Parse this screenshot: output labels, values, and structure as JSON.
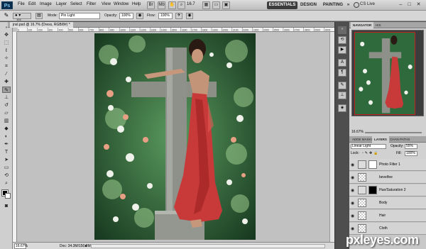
{
  "menubar": {
    "logo": "Ps",
    "menus": [
      "File",
      "Edit",
      "Image",
      "Layer",
      "Select",
      "Filter",
      "View",
      "Window",
      "Help"
    ],
    "zoom": "16.7",
    "workspaces": [
      "ESSENTIALS",
      "DESIGN",
      "PAINTING",
      "»"
    ],
    "cs_live": "CS Live",
    "window_controls": [
      "–",
      "□",
      "✕"
    ]
  },
  "options": {
    "brush_size": "104",
    "mode_label": "Mode:",
    "mode_value": "Pin Light",
    "opacity_label": "Opacity:",
    "opacity_value": "100%",
    "flow_label": "Flow:",
    "flow_value": "100%"
  },
  "document": {
    "tab_title": "jnsl.psd @ 16.7% (Dress, RGB/8#) *",
    "zoom_status": "16.67%",
    "doc_info": "Doc: 34.3M/150.2M",
    "ruler_ticks": [
      "0",
      "100",
      "200",
      "300",
      "400",
      "500",
      "600",
      "700",
      "800",
      "900",
      "1000",
      "1100",
      "1200",
      "1300",
      "1400",
      "1500",
      "1600",
      "1700",
      "1800",
      "1900",
      "2000",
      "2100",
      "2200",
      "2300",
      "2400",
      "2500",
      "2600",
      "2700",
      "2800",
      "2900",
      "3000"
    ]
  },
  "navigator": {
    "tabs": [
      "NAVIGATOR",
      "HIS"
    ],
    "zoom": "16.67%"
  },
  "layers_panel": {
    "tabs": [
      "ADDE MASKS",
      "LAYERS",
      "CHAN PATHS"
    ],
    "blend_mode": "Linear Light",
    "opacity_label": "Opacity:",
    "opacity_value": "55%",
    "lock_label": "Lock:",
    "fill_label": "Fill:",
    "fill_value": "100%",
    "layers": [
      {
        "name": "Photo Filter 1",
        "mask": "white"
      },
      {
        "name": "bevelfee",
        "mask": "none"
      },
      {
        "name": "Hue/Saturation 2",
        "mask": "black"
      },
      {
        "name": "Body",
        "mask": "none"
      },
      {
        "name": "Hair",
        "mask": "none"
      },
      {
        "name": "Cloth",
        "mask": "none"
      }
    ]
  },
  "watermark": "pxleyes.com",
  "colors": {
    "accent": "#3c3c3c",
    "dress": "#c83a3a",
    "foliage": "#2f6a3c"
  }
}
